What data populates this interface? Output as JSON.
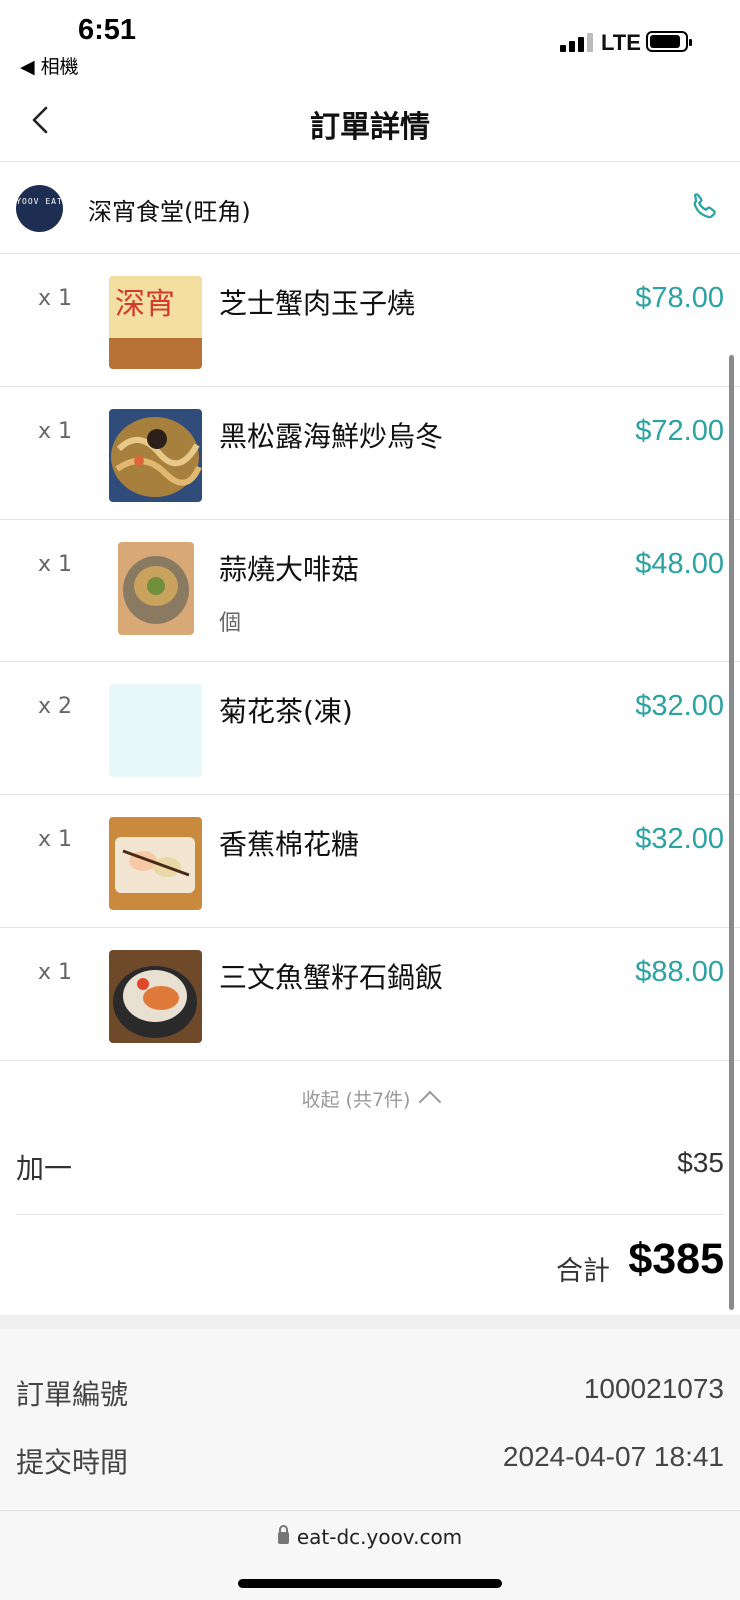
{
  "status_bar": {
    "time": "6:51",
    "back_app": "◀ 相機",
    "network": "LTE"
  },
  "header": {
    "title": "訂單詳情"
  },
  "restaurant": {
    "logo_text": "YOOV EAT",
    "name": "深宵食堂(旺角)"
  },
  "items": [
    {
      "qty": "x 1",
      "name": "芝士蟹肉玉子燒",
      "unit": "",
      "price": "$78.00"
    },
    {
      "qty": "x 1",
      "name": "黑松露海鮮炒烏冬",
      "unit": "",
      "price": "$72.00"
    },
    {
      "qty": "x 1",
      "name": "蒜燒大啡菇",
      "unit": "個",
      "price": "$48.00"
    },
    {
      "qty": "x 2",
      "name": "菊花茶(凍)",
      "unit": "",
      "price": "$32.00"
    },
    {
      "qty": "x 1",
      "name": "香蕉棉花糖",
      "unit": "",
      "price": "$32.00"
    },
    {
      "qty": "x 1",
      "name": "三文魚蟹籽石鍋飯",
      "unit": "",
      "price": "$88.00"
    }
  ],
  "collapse_label": "收起 (共7件)",
  "addon": {
    "label": "加一",
    "value": "$35"
  },
  "total": {
    "label": "合計",
    "value": "$385"
  },
  "order_info": {
    "order_no_label": "訂單編號",
    "order_no": "100021073",
    "submit_time_label": "提交時間",
    "submit_time": "2024-04-07 18:41"
  },
  "browser": {
    "url": "eat-dc.yoov.com"
  },
  "colors": {
    "accent": "#2ba3a3",
    "logo_bg": "#1d2e52"
  }
}
